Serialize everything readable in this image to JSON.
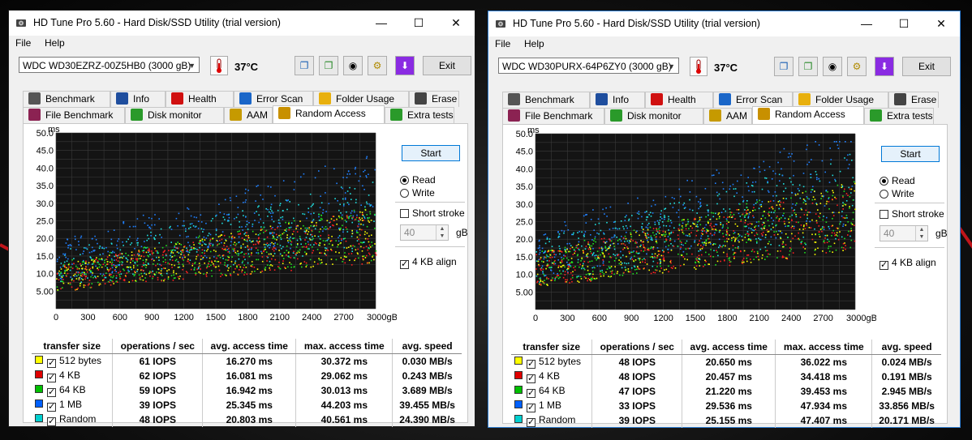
{
  "windows": [
    {
      "title": "HD Tune Pro 5.60 - Hard Disk/SSD Utility (trial version)",
      "menu": {
        "file": "File",
        "help": "Help"
      },
      "drive": "WDC WD30EZRZ-00Z5HB0 (3000 gB)",
      "temperature": "37°C",
      "exit_label": "Exit",
      "tabs_row1": [
        "Benchmark",
        "Info",
        "Health",
        "Error Scan",
        "Folder Usage",
        "Erase"
      ],
      "tabs_row2": [
        "File Benchmark",
        "Disk monitor",
        "AAM",
        "Random Access",
        "Extra tests"
      ],
      "controls": {
        "start": "Start",
        "read": "Read",
        "write": "Write",
        "short_stroke": "Short stroke",
        "stroke_value": "40",
        "stroke_unit": "gB",
        "align": "4 KB align"
      },
      "chart_data": {
        "type": "scatter",
        "ylabel": "ms",
        "ylim": [
          0,
          50
        ],
        "xlim": [
          0,
          3000
        ],
        "y_ticks": [
          "50.0",
          "45.0",
          "40.0",
          "35.0",
          "30.0",
          "25.0",
          "20.0",
          "15.0",
          "10.0",
          "5.00"
        ],
        "x_ticks": [
          "0",
          "300",
          "600",
          "900",
          "1200",
          "1500",
          "1800",
          "2100",
          "2400",
          "2700",
          "3000gB"
        ],
        "series": [
          {
            "name": "512 bytes",
            "color": "#ffff00",
            "avg_ms": 16.27,
            "max_ms": 30.372
          },
          {
            "name": "4 KB",
            "color": "#ff2020",
            "avg_ms": 16.081,
            "max_ms": 29.062
          },
          {
            "name": "64 KB",
            "color": "#20e020",
            "avg_ms": 16.942,
            "max_ms": 30.013
          },
          {
            "name": "1 MB",
            "color": "#2080ff",
            "avg_ms": 25.345,
            "max_ms": 44.203
          },
          {
            "name": "Random",
            "color": "#20e0e0",
            "avg_ms": 20.803,
            "max_ms": 40.561
          }
        ]
      },
      "table": {
        "headers": [
          "transfer size",
          "operations / sec",
          "avg. access time",
          "max. access time",
          "avg. speed"
        ],
        "rows": [
          {
            "size": "512 bytes",
            "ops": "61 IOPS",
            "avg": "16.270 ms",
            "max": "30.372 ms",
            "speed": "0.030 MB/s",
            "color": "#ffff00"
          },
          {
            "size": "4 KB",
            "ops": "62 IOPS",
            "avg": "16.081 ms",
            "max": "29.062 ms",
            "speed": "0.243 MB/s",
            "color": "#e00000"
          },
          {
            "size": "64 KB",
            "ops": "59 IOPS",
            "avg": "16.942 ms",
            "max": "30.013 ms",
            "speed": "3.689 MB/s",
            "color": "#00c000"
          },
          {
            "size": "1 MB",
            "ops": "39 IOPS",
            "avg": "25.345 ms",
            "max": "44.203 ms",
            "speed": "39.455 MB/s",
            "color": "#0060ff"
          },
          {
            "size": "Random",
            "ops": "48 IOPS",
            "avg": "20.803 ms",
            "max": "40.561 ms",
            "speed": "24.390 MB/s",
            "color": "#00d0d0"
          }
        ]
      }
    },
    {
      "title": "HD Tune Pro 5.60 - Hard Disk/SSD Utility (trial version)",
      "menu": {
        "file": "File",
        "help": "Help"
      },
      "drive": "WDC WD30PURX-64P6ZY0 (3000 gB)",
      "temperature": "37°C",
      "exit_label": "Exit",
      "tabs_row1": [
        "Benchmark",
        "Info",
        "Health",
        "Error Scan",
        "Folder Usage",
        "Erase"
      ],
      "tabs_row2": [
        "File Benchmark",
        "Disk monitor",
        "AAM",
        "Random Access",
        "Extra tests"
      ],
      "controls": {
        "start": "Start",
        "read": "Read",
        "write": "Write",
        "short_stroke": "Short stroke",
        "stroke_value": "40",
        "stroke_unit": "gB",
        "align": "4 KB align"
      },
      "chart_data": {
        "type": "scatter",
        "ylabel": "ms",
        "ylim": [
          0,
          50
        ],
        "xlim": [
          0,
          3000
        ],
        "y_ticks": [
          "50.0",
          "45.0",
          "40.0",
          "35.0",
          "30.0",
          "25.0",
          "20.0",
          "15.0",
          "10.0",
          "5.00"
        ],
        "x_ticks": [
          "0",
          "300",
          "600",
          "900",
          "1200",
          "1500",
          "1800",
          "2100",
          "2400",
          "2700",
          "3000gB"
        ],
        "series": [
          {
            "name": "512 bytes",
            "color": "#ffff00",
            "avg_ms": 20.65,
            "max_ms": 36.022
          },
          {
            "name": "4 KB",
            "color": "#ff2020",
            "avg_ms": 20.457,
            "max_ms": 34.418
          },
          {
            "name": "64 KB",
            "color": "#20e020",
            "avg_ms": 21.22,
            "max_ms": 39.453
          },
          {
            "name": "1 MB",
            "color": "#2080ff",
            "avg_ms": 29.536,
            "max_ms": 47.934
          },
          {
            "name": "Random",
            "color": "#20e0e0",
            "avg_ms": 25.155,
            "max_ms": 47.407
          }
        ]
      },
      "table": {
        "headers": [
          "transfer size",
          "operations / sec",
          "avg. access time",
          "max. access time",
          "avg. speed"
        ],
        "rows": [
          {
            "size": "512 bytes",
            "ops": "48 IOPS",
            "avg": "20.650 ms",
            "max": "36.022 ms",
            "speed": "0.024 MB/s",
            "color": "#ffff00"
          },
          {
            "size": "4 KB",
            "ops": "48 IOPS",
            "avg": "20.457 ms",
            "max": "34.418 ms",
            "speed": "0.191 MB/s",
            "color": "#e00000"
          },
          {
            "size": "64 KB",
            "ops": "47 IOPS",
            "avg": "21.220 ms",
            "max": "39.453 ms",
            "speed": "2.945 MB/s",
            "color": "#00c000"
          },
          {
            "size": "1 MB",
            "ops": "33 IOPS",
            "avg": "29.536 ms",
            "max": "47.934 ms",
            "speed": "33.856 MB/s",
            "color": "#0060ff"
          },
          {
            "size": "Random",
            "ops": "39 IOPS",
            "avg": "25.155 ms",
            "max": "47.407 ms",
            "speed": "20.171 MB/s",
            "color": "#00d0d0"
          }
        ]
      }
    }
  ]
}
